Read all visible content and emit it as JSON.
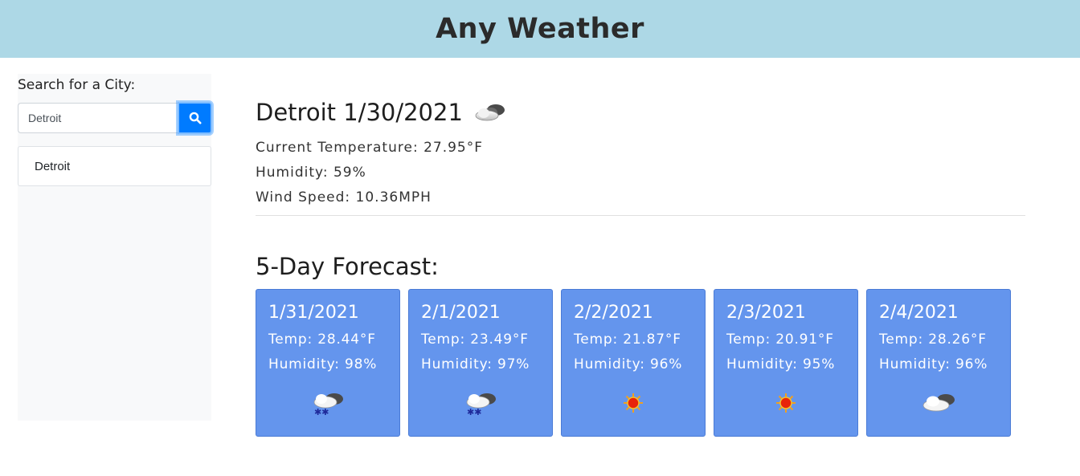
{
  "header": {
    "title": "Any Weather",
    "color": "#add8e6"
  },
  "sidebar": {
    "search_label": "Search for a City:",
    "search_value": "Detroit",
    "search_icon": "search-icon",
    "history": [
      {
        "label": "Detroit"
      }
    ]
  },
  "current": {
    "title": "Detroit 1/30/2021",
    "icon": "cloud-icon",
    "temperature": "Current Temperature: 27.95°F",
    "humidity": "Humidity: 59%",
    "wind": "Wind Speed: 10.36MPH"
  },
  "forecast": {
    "title": "5-Day Forecast:",
    "card_color": "#6495ed",
    "days": [
      {
        "date": "1/31/2021",
        "temp": "Temp: 28.44°F",
        "humidity": "Humidity: 98%",
        "icon": "snow-icon"
      },
      {
        "date": "2/1/2021",
        "temp": "Temp: 23.49°F",
        "humidity": "Humidity: 97%",
        "icon": "snow-icon"
      },
      {
        "date": "2/2/2021",
        "temp": "Temp: 21.87°F",
        "humidity": "Humidity: 96%",
        "icon": "sun-icon"
      },
      {
        "date": "2/3/2021",
        "temp": "Temp: 20.91°F",
        "humidity": "Humidity: 95%",
        "icon": "sun-icon"
      },
      {
        "date": "2/4/2021",
        "temp": "Temp: 28.26°F",
        "humidity": "Humidity: 96%",
        "icon": "cloud-icon"
      }
    ]
  }
}
